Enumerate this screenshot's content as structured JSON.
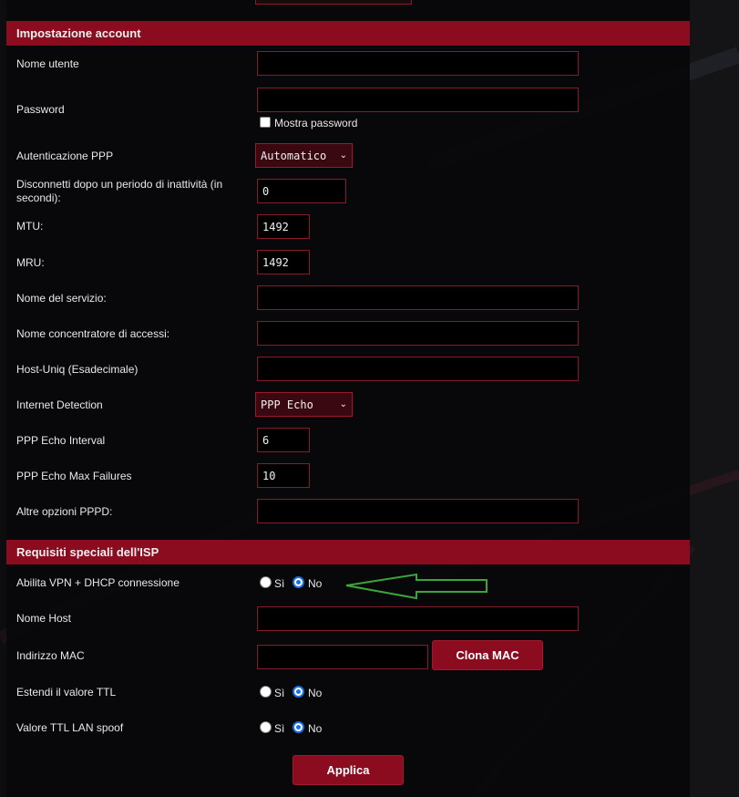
{
  "colors": {
    "accent": "#8b0b1f",
    "radio_selected": "#1a6fe6",
    "arrow": "#3aa53a"
  },
  "account": {
    "section_title": "Impostazione account",
    "username": {
      "label": "Nome utente",
      "value": ""
    },
    "password": {
      "label": "Password",
      "value": "",
      "show_password_label": "Mostra password"
    },
    "ppp_auth": {
      "label": "Autenticazione PPP",
      "selected": "Automatico"
    },
    "idle_disconnect": {
      "label": "Disconnetti dopo un periodo di inattività (in secondi):",
      "value": "0"
    },
    "mtu": {
      "label": "MTU:",
      "value": "1492"
    },
    "mru": {
      "label": "MRU:",
      "value": "1492"
    },
    "service_name": {
      "label": "Nome del servizio:",
      "value": ""
    },
    "ac_name": {
      "label": "Nome concentratore di accessi:",
      "value": ""
    },
    "host_uniq": {
      "label": "Host-Uniq (Esadecimale)",
      "value": ""
    },
    "internet_detection": {
      "label": "Internet Detection",
      "selected": "PPP Echo"
    },
    "echo_interval": {
      "label": "PPP Echo Interval",
      "value": "6"
    },
    "echo_max_failures": {
      "label": "PPP Echo Max Failures",
      "value": "10"
    },
    "pppd_options": {
      "label": "Altre opzioni PPPD:",
      "value": ""
    }
  },
  "isp": {
    "section_title": "Requisiti speciali dell'ISP",
    "vpn_dhcp": {
      "label": "Abilita VPN + DHCP connessione",
      "yes": "Sì",
      "no": "No",
      "selected": "No"
    },
    "host_name": {
      "label": "Nome Host",
      "value": ""
    },
    "mac": {
      "label": "Indirizzo MAC",
      "value": "",
      "clone_button": "Clona MAC"
    },
    "ttl_extend": {
      "label": "Estendi il valore TTL",
      "yes": "Sì",
      "no": "No",
      "selected": "No"
    },
    "ttl_spoof": {
      "label": "Valore TTL LAN spoof",
      "yes": "Sì",
      "no": "No",
      "selected": "No"
    }
  },
  "apply_button": "Applica"
}
